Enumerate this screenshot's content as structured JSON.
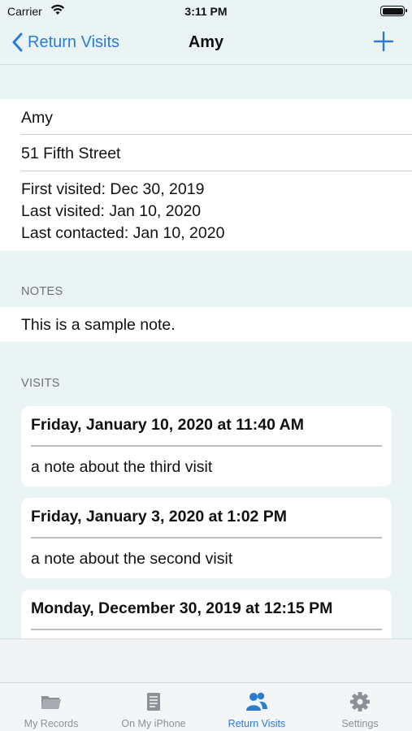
{
  "status_bar": {
    "carrier": "Carrier",
    "time": "3:11 PM"
  },
  "nav": {
    "back_label": "Return Visits",
    "title": "Amy"
  },
  "person": {
    "name": "Amy",
    "address": "51 Fifth Street",
    "first_visited": "First visited: Dec 30, 2019",
    "last_visited": "Last visited: Jan 10, 2020",
    "last_contacted": "Last contacted: Jan 10, 2020"
  },
  "notes": {
    "header": "NOTES",
    "text": "This is a sample note."
  },
  "visits": {
    "header": "VISITS",
    "items": [
      {
        "date": "Friday, January 10, 2020 at 11:40 AM",
        "note": "a note about the third visit"
      },
      {
        "date": "Friday, January 3, 2020 at 1:02 PM",
        "note": "a note about the second visit"
      },
      {
        "date": "Monday, December 30, 2019 at 12:15 PM",
        "note": ""
      }
    ]
  },
  "tabs": [
    {
      "label": "My Records",
      "icon": "folder-icon",
      "active": false
    },
    {
      "label": "On My iPhone",
      "icon": "document-icon",
      "active": false
    },
    {
      "label": "Return Visits",
      "icon": "people-icon",
      "active": true
    },
    {
      "label": "Settings",
      "icon": "gear-icon",
      "active": false
    }
  ],
  "colors": {
    "accent": "#2b7cd3",
    "background": "#eaf4f5",
    "inactive_tab": "#8b9196"
  }
}
